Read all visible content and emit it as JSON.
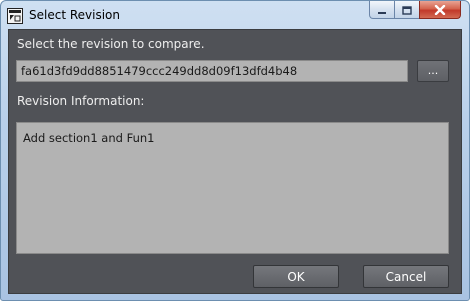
{
  "window": {
    "title": "Select Revision",
    "icon": "app-window-icon"
  },
  "caption_buttons": {
    "minimize_icon": "minimize-icon",
    "maximize_icon": "maximize-icon",
    "close_icon": "close-icon"
  },
  "dialog": {
    "prompt": "Select the revision to compare.",
    "revision_value": "fa61d3fd9dd8851479ccc249dd8d09f13dfd4b48",
    "browse_label": "...",
    "info_label": "Revision Information:",
    "info_text": "Add section1 and Fun1",
    "ok_label": "OK",
    "cancel_label": "Cancel"
  },
  "colors": {
    "client_background": "#505257",
    "field_background": "#b3b3b3",
    "text_light": "#eeeeee",
    "close_button": "#c2392a",
    "title_gradient": "#b9d0ea"
  }
}
